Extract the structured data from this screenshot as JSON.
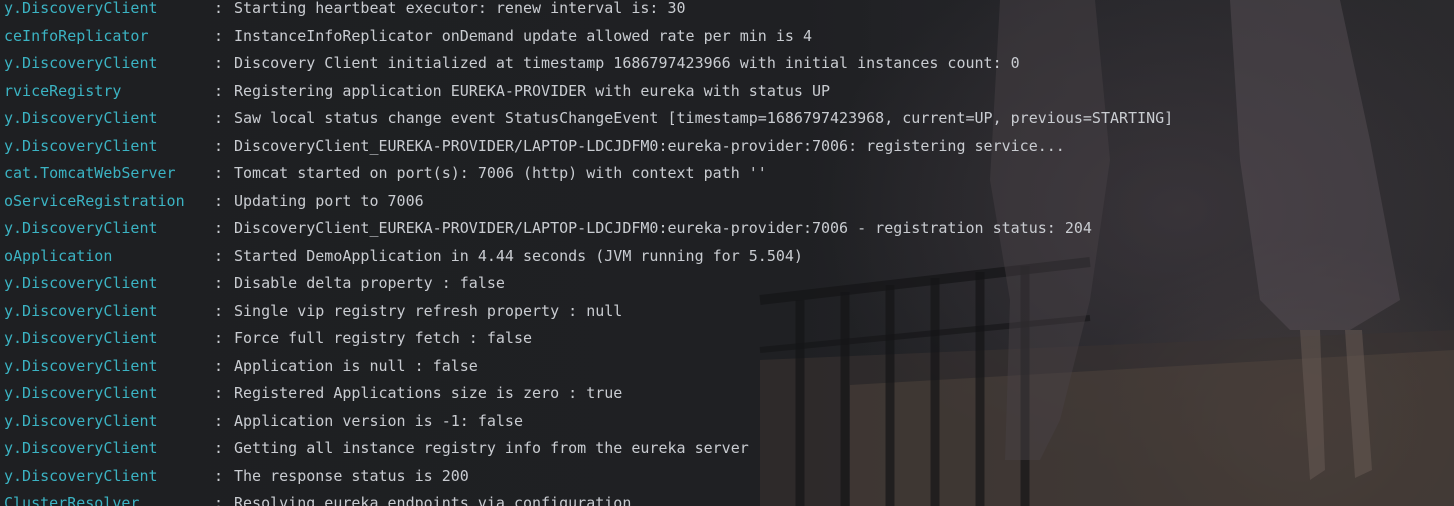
{
  "console": {
    "separator": ":",
    "lines": [
      {
        "logger": "y.DiscoveryClient",
        "message": "Starting heartbeat executor: renew interval is: 30"
      },
      {
        "logger": "ceInfoReplicator",
        "message": "InstanceInfoReplicator onDemand update allowed rate per min is 4"
      },
      {
        "logger": "y.DiscoveryClient",
        "message": "Discovery Client initialized at timestamp 1686797423966 with initial instances count: 0"
      },
      {
        "logger": "rviceRegistry",
        "message": "Registering application EUREKA-PROVIDER with eureka with status UP"
      },
      {
        "logger": "y.DiscoveryClient",
        "message": "Saw local status change event StatusChangeEvent [timestamp=1686797423968, current=UP, previous=STARTING]"
      },
      {
        "logger": "y.DiscoveryClient",
        "message": "DiscoveryClient_EUREKA-PROVIDER/LAPTOP-LDCJDFM0:eureka-provider:7006: registering service..."
      },
      {
        "logger": "cat.TomcatWebServer",
        "message": "Tomcat started on port(s): 7006 (http) with context path ''"
      },
      {
        "logger": "oServiceRegistration",
        "message": "Updating port to 7006"
      },
      {
        "logger": "y.DiscoveryClient",
        "message": "DiscoveryClient_EUREKA-PROVIDER/LAPTOP-LDCJDFM0:eureka-provider:7006 - registration status: 204"
      },
      {
        "logger": "oApplication",
        "message": "Started DemoApplication in 4.44 seconds (JVM running for 5.504)"
      },
      {
        "logger": "y.DiscoveryClient",
        "message": "Disable delta property : false"
      },
      {
        "logger": "y.DiscoveryClient",
        "message": "Single vip registry refresh property : null"
      },
      {
        "logger": "y.DiscoveryClient",
        "message": "Force full registry fetch : false"
      },
      {
        "logger": "y.DiscoveryClient",
        "message": "Application is null : false"
      },
      {
        "logger": "y.DiscoveryClient",
        "message": "Registered Applications size is zero : true"
      },
      {
        "logger": "y.DiscoveryClient",
        "message": "Application version is -1: false"
      },
      {
        "logger": "y.DiscoveryClient",
        "message": "Getting all instance registry info from the eureka server"
      },
      {
        "logger": "y.DiscoveryClient",
        "message": "The response status is 200"
      },
      {
        "logger": "ClusterResolver",
        "message": "Resolving eureka endpoints via configuration"
      }
    ]
  },
  "colors": {
    "logger": "#3bb3c3",
    "message": "#c9ccd1",
    "background": "#1f2023"
  }
}
